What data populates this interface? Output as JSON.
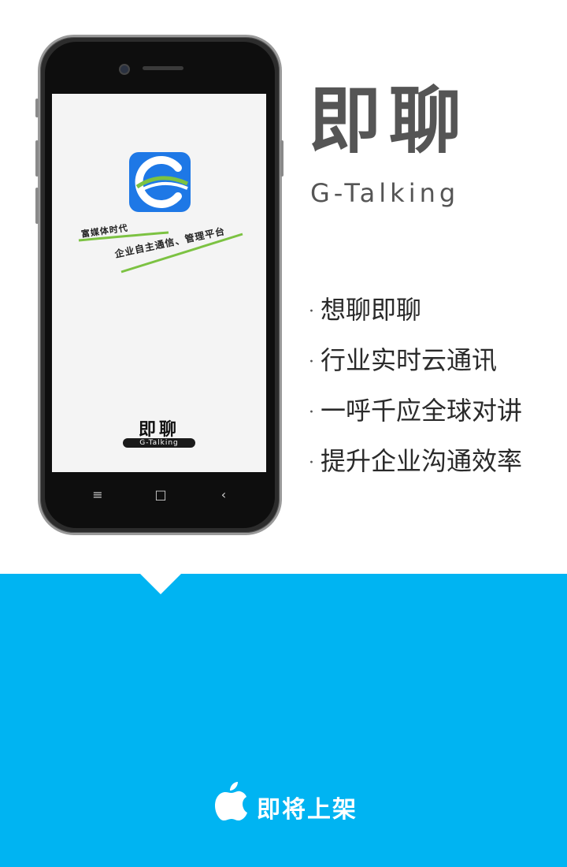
{
  "phone": {
    "screen": {
      "slogan_line1": "富媒体时代",
      "slogan_line2": "企业自主通信、管理平台",
      "logo_cn": "即聊",
      "logo_en": "G-Talking"
    },
    "nav_keys": {
      "menu": "≡",
      "home": "□",
      "back": "‹"
    }
  },
  "brand": {
    "name_cn": "即聊",
    "name_en": "G-Talking"
  },
  "features": [
    "想聊即聊",
    "行业实时云通讯",
    "一呼千应全球对讲",
    "提升企业沟通效率"
  ],
  "bullet": "·",
  "footer": {
    "cta": "即将上架",
    "icon": "apple-icon"
  },
  "colors": {
    "band": "#00b4f2",
    "brand_gray": "#555555",
    "app_icon": "#1e78e6",
    "swoosh_green": "#7cc242"
  }
}
